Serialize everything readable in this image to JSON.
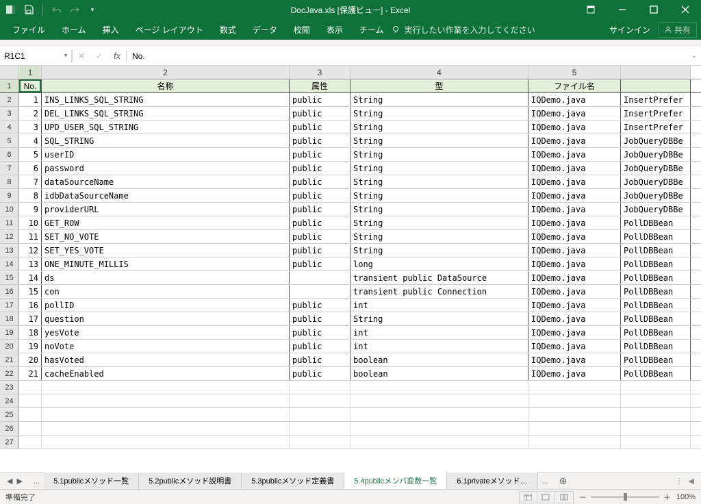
{
  "title": "DocJava.xls  [保護ビュー] - Excel",
  "qat": {
    "save": "保存",
    "undo": "元に戻す",
    "redo": "やり直し"
  },
  "winControls": {
    "ribbonOpts": "リボン表示オプション",
    "min": "最小化",
    "max": "最大化",
    "close": "閉じる"
  },
  "ribbon": {
    "tabs": [
      "ファイル",
      "ホーム",
      "挿入",
      "ページ レイアウト",
      "数式",
      "データ",
      "校閲",
      "表示",
      "チーム"
    ],
    "tellMe": "実行したい作業を入力してください",
    "signIn": "サインイン",
    "share": "共有"
  },
  "formulaBar": {
    "nameBox": "R1C1",
    "cancel": "✕",
    "enter": "✓",
    "fx": "fx",
    "value": "No."
  },
  "columns": [
    "1",
    "2",
    "3",
    "4",
    "5",
    ""
  ],
  "headerRow": {
    "no": "No.",
    "name": "名称",
    "attr": "属性",
    "type": "型",
    "file": "ファイル名",
    "cls": ""
  },
  "rows": [
    {
      "r": "2",
      "no": "1",
      "name": "INS_LINKS_SQL_STRING",
      "attr": "public",
      "type": "String",
      "file": "IQDemo.java",
      "cls": "InsertPrefer"
    },
    {
      "r": "3",
      "no": "2",
      "name": "DEL_LINKS_SQL_STRING",
      "attr": "public",
      "type": "String",
      "file": "IQDemo.java",
      "cls": "InsertPrefer"
    },
    {
      "r": "4",
      "no": "3",
      "name": "UPD_USER_SQL_STRING",
      "attr": "public",
      "type": "String",
      "file": "IQDemo.java",
      "cls": "InsertPrefer"
    },
    {
      "r": "5",
      "no": "4",
      "name": "SQL_STRING",
      "attr": "public",
      "type": "String",
      "file": "IQDemo.java",
      "cls": "JobQueryDBBe"
    },
    {
      "r": "6",
      "no": "5",
      "name": "userID",
      "attr": "public",
      "type": "String",
      "file": "IQDemo.java",
      "cls": "JobQueryDBBe"
    },
    {
      "r": "7",
      "no": "6",
      "name": "password",
      "attr": "public",
      "type": "String",
      "file": "IQDemo.java",
      "cls": "JobQueryDBBe"
    },
    {
      "r": "8",
      "no": "7",
      "name": "dataSourceName",
      "attr": "public",
      "type": "String",
      "file": "IQDemo.java",
      "cls": "JobQueryDBBe"
    },
    {
      "r": "9",
      "no": "8",
      "name": "idbDataSourceName",
      "attr": "public",
      "type": "String",
      "file": "IQDemo.java",
      "cls": "JobQueryDBBe"
    },
    {
      "r": "10",
      "no": "9",
      "name": "providerURL",
      "attr": "public",
      "type": "String",
      "file": "IQDemo.java",
      "cls": "JobQueryDBBe"
    },
    {
      "r": "11",
      "no": "10",
      "name": "GET_ROW",
      "attr": "public",
      "type": "String",
      "file": "IQDemo.java",
      "cls": "PollDBBean"
    },
    {
      "r": "12",
      "no": "11",
      "name": "SET_NO_VOTE",
      "attr": "public",
      "type": "String",
      "file": "IQDemo.java",
      "cls": "PollDBBean"
    },
    {
      "r": "13",
      "no": "12",
      "name": "SET_YES_VOTE",
      "attr": "public",
      "type": "String",
      "file": "IQDemo.java",
      "cls": "PollDBBean"
    },
    {
      "r": "14",
      "no": "13",
      "name": "ONE_MINUTE_MILLIS",
      "attr": "public",
      "type": "long",
      "file": "IQDemo.java",
      "cls": "PollDBBean"
    },
    {
      "r": "15",
      "no": "14",
      "name": "ds",
      "attr": "",
      "type": "transient public DataSource",
      "file": "IQDemo.java",
      "cls": "PollDBBean"
    },
    {
      "r": "16",
      "no": "15",
      "name": "con",
      "attr": "",
      "type": "transient public Connection",
      "file": "IQDemo.java",
      "cls": "PollDBBean"
    },
    {
      "r": "17",
      "no": "16",
      "name": "pollID",
      "attr": "public",
      "type": "int",
      "file": "IQDemo.java",
      "cls": "PollDBBean"
    },
    {
      "r": "18",
      "no": "17",
      "name": "question",
      "attr": "public",
      "type": "String",
      "file": "IQDemo.java",
      "cls": "PollDBBean"
    },
    {
      "r": "19",
      "no": "18",
      "name": "yesVote",
      "attr": "public",
      "type": "int",
      "file": "IQDemo.java",
      "cls": "PollDBBean"
    },
    {
      "r": "20",
      "no": "19",
      "name": "noVote",
      "attr": "public",
      "type": "int",
      "file": "IQDemo.java",
      "cls": "PollDBBean"
    },
    {
      "r": "21",
      "no": "20",
      "name": "hasVoted",
      "attr": "public",
      "type": "boolean",
      "file": "IQDemo.java",
      "cls": "PollDBBean"
    },
    {
      "r": "22",
      "no": "21",
      "name": "cacheEnabled",
      "attr": "public",
      "type": "boolean",
      "file": "IQDemo.java",
      "cls": "PollDBBean"
    }
  ],
  "emptyRows": [
    "23",
    "24",
    "25",
    "26",
    "27"
  ],
  "sheetTabs": {
    "dots": "...",
    "list": [
      "5.1publicメソッド一覧",
      "5.2publicメソッド説明書",
      "5.3publicメソッド定義書",
      "5.4publicメンバ変数一覧",
      "6.1privateメソッド…"
    ],
    "active": 3,
    "add": "⊕"
  },
  "statusBar": {
    "ready": "準備完了",
    "zoom": "100%",
    "minus": "－",
    "plus": "＋"
  }
}
